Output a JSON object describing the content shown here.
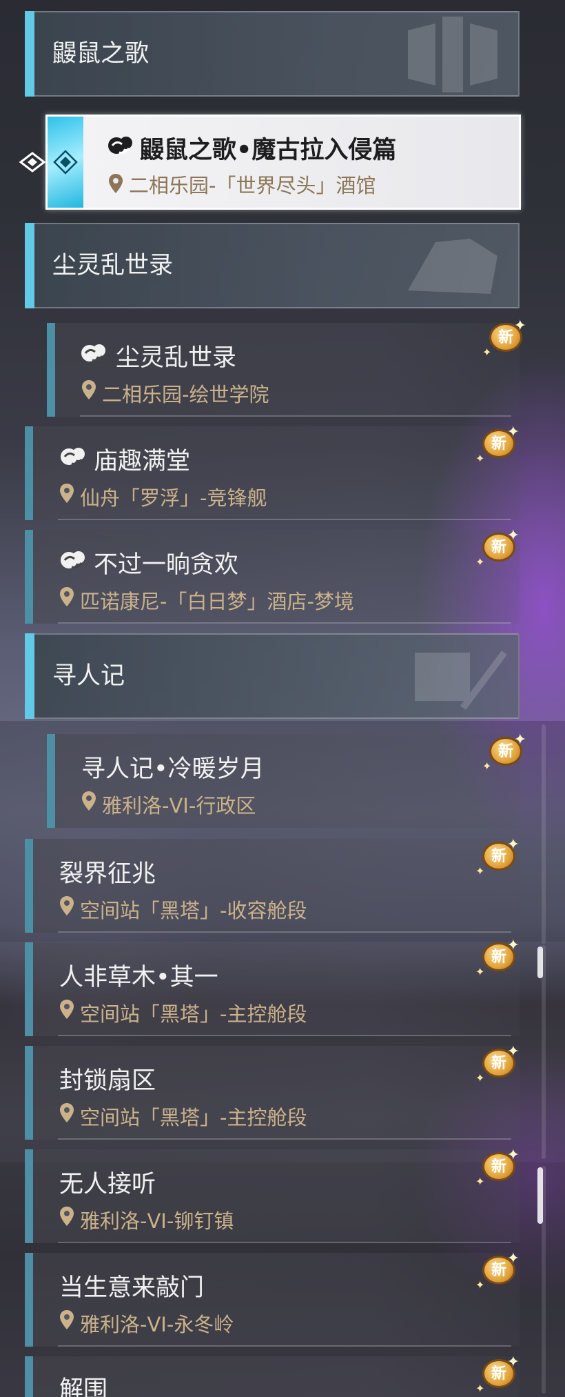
{
  "categories": [
    {
      "title": "鼹鼠之歌"
    },
    {
      "title": "尘灵乱世录"
    },
    {
      "title": "寻人记"
    }
  ],
  "selected_quest": {
    "title": "鼹鼠之歌•魔古拉入侵篇",
    "location": "二相乐园-「世界尽头」酒馆",
    "icon": "event-quest-icon"
  },
  "quests": [
    {
      "title": "尘灵乱世录",
      "location": "二相乐园-绘世学院",
      "has_icon": true,
      "badge": "新"
    },
    {
      "title": "庙趣满堂",
      "location": "仙舟「罗浮」-竞锋舰",
      "has_icon": true,
      "badge": "新"
    },
    {
      "title": "不过一晌贪欢",
      "location": "匹诺康尼-「白日梦」酒店-梦境",
      "has_icon": true,
      "badge": "新"
    },
    {
      "title": "寻人记•冷暖岁月",
      "location": "雅利洛-VI-行政区",
      "has_icon": false,
      "badge": "新"
    },
    {
      "title": "裂界征兆",
      "location": "空间站「黑塔」-收容舱段",
      "has_icon": false,
      "badge": "新"
    },
    {
      "title": "人非草木•其一",
      "location": "空间站「黑塔」-主控舱段",
      "has_icon": false,
      "badge": "新"
    },
    {
      "title": "封锁扇区",
      "location": "空间站「黑塔」-主控舱段",
      "has_icon": false,
      "badge": "新"
    },
    {
      "title": "无人接听",
      "location": "雅利洛-VI-铆钉镇",
      "has_icon": false,
      "badge": "新"
    },
    {
      "title": "当生意来敲门",
      "location": "雅利洛-VI-永冬岭",
      "has_icon": false,
      "badge": "新"
    },
    {
      "title": "解围",
      "location": "",
      "has_icon": false,
      "badge": "新"
    }
  ],
  "colors": {
    "accent_cyan": "#62c9e6",
    "quest_bar": "#4d8fa4",
    "location_gold": "#cbb28b",
    "badge_gold": "#e2a23b"
  }
}
